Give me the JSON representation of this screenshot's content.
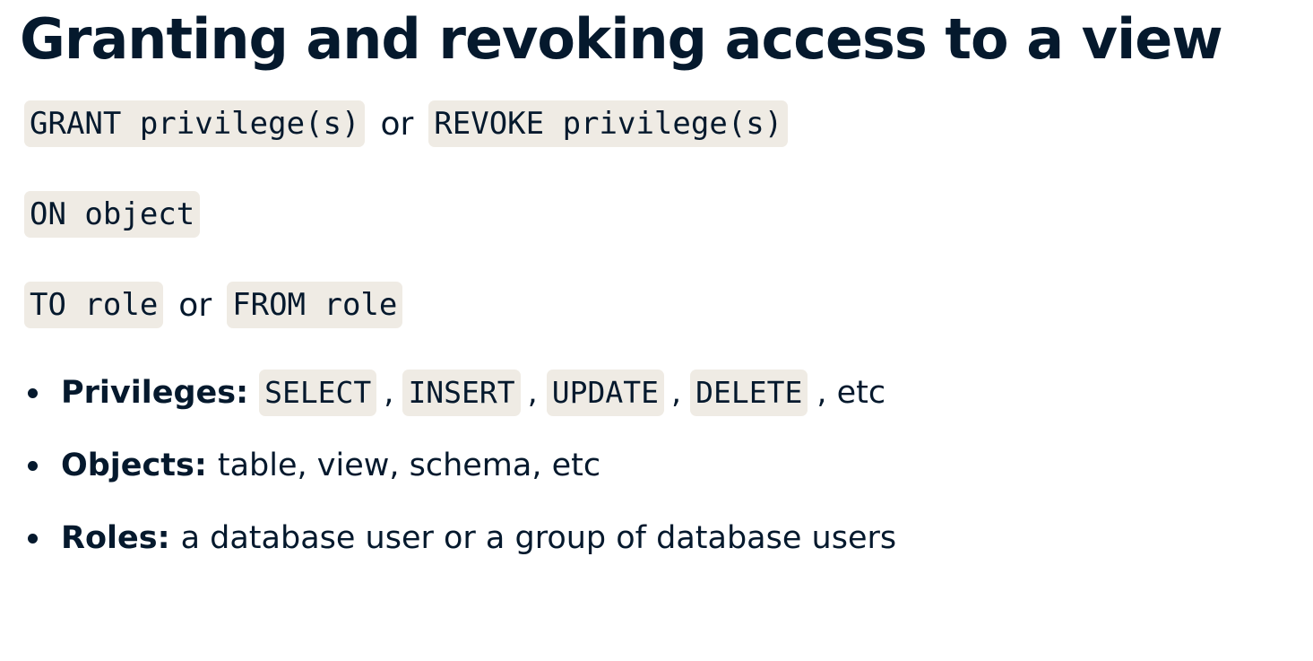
{
  "title": "Granting and revoking access to a view",
  "syntax": {
    "line1": {
      "grant": "GRANT privilege(s)",
      "or": "or",
      "revoke": "REVOKE privilege(s)"
    },
    "line2": {
      "on": "ON object"
    },
    "line3": {
      "to": "TO role",
      "or": "or",
      "from": "FROM role"
    }
  },
  "bullets": {
    "privileges": {
      "label": "Privileges:",
      "items": [
        "SELECT",
        "INSERT",
        "UPDATE",
        "DELETE"
      ],
      "separator": ",",
      "suffix": ", etc"
    },
    "objects": {
      "label": "Objects:",
      "text": "table, view, schema, etc"
    },
    "roles": {
      "label": "Roles:",
      "text": "a database user or a group of database users"
    }
  },
  "colors": {
    "text": "#05192d",
    "code_background": "#efebe4",
    "background": "#ffffff"
  }
}
